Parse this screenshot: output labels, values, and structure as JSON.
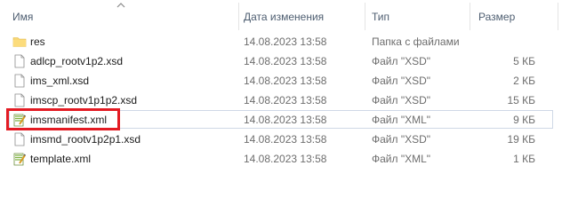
{
  "columns": {
    "name": "Имя",
    "date": "Дата изменения",
    "type": "Тип",
    "size": "Размер"
  },
  "files": [
    {
      "name": "res",
      "date": "14.08.2023 13:58",
      "type": "Папка с файлами",
      "size": "",
      "icon": "folder-icon"
    },
    {
      "name": "adlcp_rootv1p2.xsd",
      "date": "14.08.2023 13:58",
      "type": "Файл \"XSD\"",
      "size": "5 КБ",
      "icon": "file-icon"
    },
    {
      "name": "ims_xml.xsd",
      "date": "14.08.2023 13:58",
      "type": "Файл \"XSD\"",
      "size": "2 КБ",
      "icon": "file-icon"
    },
    {
      "name": "imscp_rootv1p1p2.xsd",
      "date": "14.08.2023 13:58",
      "type": "Файл \"XSD\"",
      "size": "15 КБ",
      "icon": "file-icon"
    },
    {
      "name": "imsmanifest.xml",
      "date": "14.08.2023 13:58",
      "type": "Файл \"XML\"",
      "size": "9 КБ",
      "icon": "xml-file-icon"
    },
    {
      "name": "imsmd_rootv1p2p1.xsd",
      "date": "14.08.2023 13:58",
      "type": "Файл \"XSD\"",
      "size": "19 КБ",
      "icon": "file-icon"
    },
    {
      "name": "template.xml",
      "date": "14.08.2023 13:58",
      "type": "Файл \"XML\"",
      "size": "1 КБ",
      "icon": "xml-file-icon"
    }
  ],
  "colors": {
    "highlight_border": "#e31b23",
    "folder_yellow": "#f8d775",
    "header_text": "#4d5d70"
  }
}
